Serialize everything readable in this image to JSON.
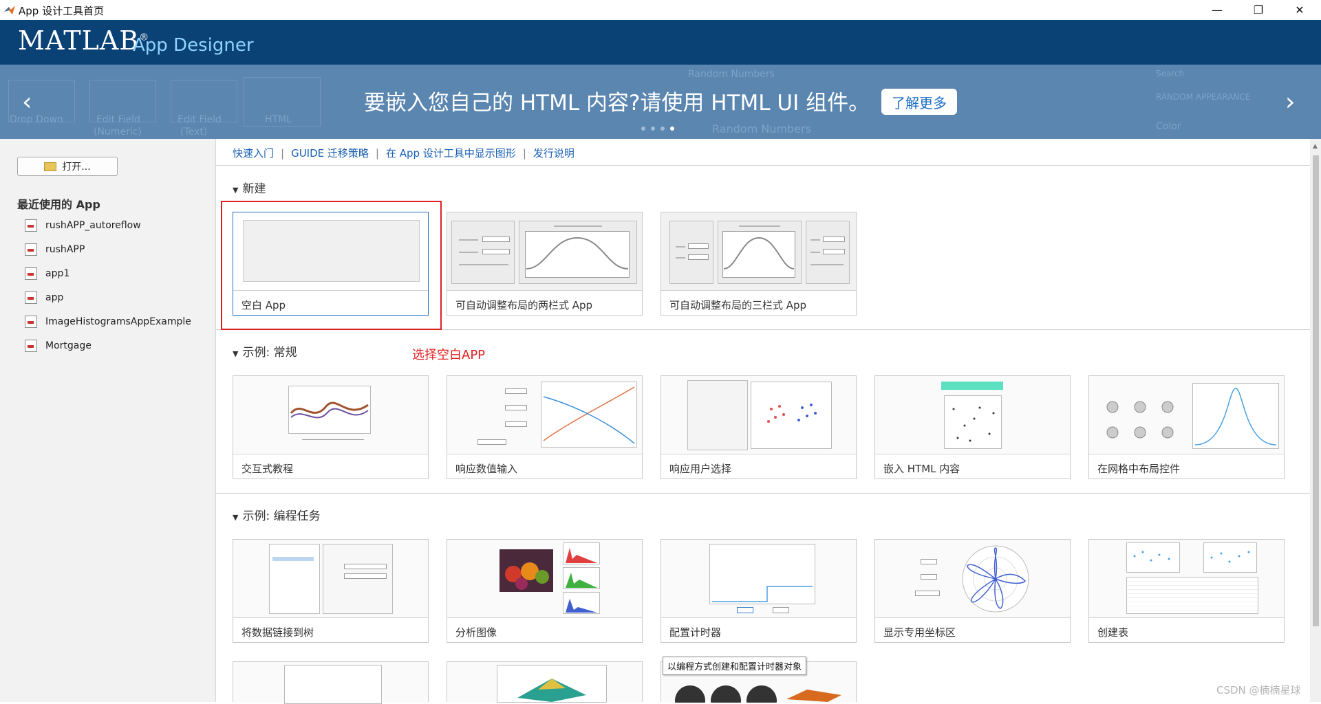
{
  "window": {
    "title": "App 设计工具首页",
    "minimize": "—",
    "restore": "❐",
    "close": "✕"
  },
  "header": {
    "brand": "MATLAB",
    "reg": "®",
    "product": "App Designer"
  },
  "banner": {
    "text": "要嵌入您自己的 HTML 内容?请使用 HTML UI 组件。",
    "button": "了解更多",
    "prev": "‹",
    "next": "›",
    "slides": 4,
    "active_slide": 4,
    "ghost_labels": [
      "Drop Down",
      "Edit Field",
      "(Numeric)",
      "Edit Field",
      "(Text)",
      "HTML",
      "Random Numbers",
      "Random Numbers",
      "Color",
      "RANDOM APPEARANCE",
      "Search"
    ]
  },
  "sidebar": {
    "open_label": "打开...",
    "recent_title": "最近使用的 App",
    "recent": [
      "rushAPP_autoreflow",
      "rushAPP",
      "app1",
      "app",
      "ImageHistogramsAppExample",
      "Mortgage"
    ]
  },
  "links": [
    "快速入门",
    "GUIDE 迁移策略",
    "在 App 设计工具中显示图形",
    "发行说明"
  ],
  "sections": {
    "new": {
      "title": "新建",
      "items": [
        "空白 App",
        "可自动调整布局的两栏式 App",
        "可自动调整布局的三栏式 App"
      ]
    },
    "general": {
      "title": "示例: 常规",
      "items": [
        "交互式教程",
        "响应数值输入",
        "响应用户选择",
        "嵌入 HTML 内容",
        "在网格中布局控件"
      ]
    },
    "programming": {
      "title": "示例: 编程任务",
      "items": [
        "将数据链接到树",
        "分析图像",
        "配置计时器",
        "显示专用坐标区",
        "创建表"
      ]
    }
  },
  "annotation": "选择空白APP",
  "tooltip": "以编程方式创建和配置计时器对象",
  "watermark": "CSDN @楠楠星球"
}
